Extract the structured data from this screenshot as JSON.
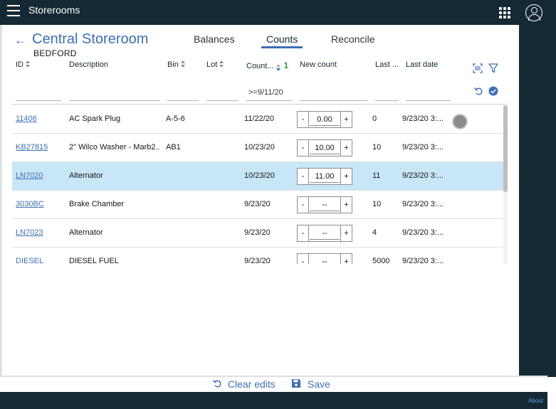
{
  "app": {
    "title": "Storerooms"
  },
  "header": {
    "title": "Central Storeroom",
    "subtitle": "BEDFORD"
  },
  "tabs": [
    {
      "label": "Balances",
      "active": false
    },
    {
      "label": "Counts",
      "active": true
    },
    {
      "label": "Reconcile",
      "active": false
    }
  ],
  "columns": {
    "id": "ID",
    "description": "Description",
    "bin": "Bin",
    "lot": "Lot",
    "count": "Count...",
    "sort_count": "1",
    "new_count": "New count",
    "last": "Last ...",
    "last_date": "Last date"
  },
  "filters": {
    "id": "",
    "description": "",
    "bin": "",
    "lot": "",
    "count": ">=9/11/20",
    "new_count": "",
    "last": "",
    "last_date": ""
  },
  "stepper": {
    "minus": "-",
    "plus": "+"
  },
  "rows": [
    {
      "id": "11406",
      "description": "AC Spark Plug",
      "bin": "A-5-6",
      "lot": "",
      "count_date": "11/22/20",
      "new_count": "0.00",
      "last": "0",
      "last_date": "9/23/20 3:...",
      "selected": false,
      "busy": true
    },
    {
      "id": "KB27815",
      "description": "2\" Wilco Washer - Marb2...",
      "bin": "AB1",
      "lot": "",
      "count_date": "10/23/20",
      "new_count": "10.00",
      "last": "10",
      "last_date": "9/23/20 3:...",
      "selected": false,
      "busy": false
    },
    {
      "id": "LN7020",
      "description": "Alternator",
      "bin": "",
      "lot": "",
      "count_date": "10/23/20",
      "new_count": "11.00",
      "last": "11",
      "last_date": "9/23/20 3:...",
      "selected": true,
      "busy": false
    },
    {
      "id": "3030BC",
      "description": "Brake Chamber",
      "bin": "",
      "lot": "",
      "count_date": "9/23/20",
      "new_count": "--",
      "last": "10",
      "last_date": "9/23/20 3:...",
      "selected": false,
      "busy": false
    },
    {
      "id": "LN7023",
      "description": "Alternator",
      "bin": "",
      "lot": "",
      "count_date": "9/23/20",
      "new_count": "--",
      "last": "4",
      "last_date": "9/23/20 3:...",
      "selected": false,
      "busy": false
    },
    {
      "id": "DIESEL",
      "description": "DIESEL FUEL",
      "bin": "",
      "lot": "",
      "count_date": "9/23/20",
      "new_count": "--",
      "last": "5000",
      "last_date": "9/23/20 3:...",
      "selected": false,
      "busy": false
    }
  ],
  "footer": {
    "clear_label": "Clear edits",
    "save_label": "Save",
    "about_label": "About"
  },
  "colors": {
    "brand_dark": "#152935",
    "accent": "#3d70b2",
    "selected_row": "#c7e6f7",
    "sort_badge": "#37a436"
  }
}
